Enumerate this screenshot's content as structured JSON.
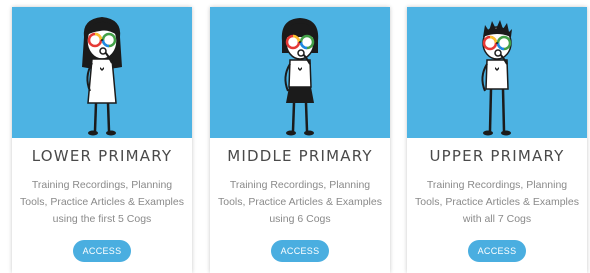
{
  "colors": {
    "hero_background": "#4db3e3",
    "button_background": "#4aaee0",
    "title_text": "#4a4a4a",
    "description_text": "#8a8a8a"
  },
  "cards": [
    {
      "title": "LOWER PRIMARY",
      "description": "Training Recordings, Planning Tools, Practice Articles & Examples using the first 5 Cogs",
      "button_label": "ACCESS",
      "illustration_icon": "girl-long-hair-rainbow-glasses-icon"
    },
    {
      "title": "MIDDLE PRIMARY",
      "description": "Training Recordings, Planning Tools, Practice Articles & Examples using 6 Cogs",
      "button_label": "ACCESS",
      "illustration_icon": "girl-bob-hair-rainbow-glasses-icon"
    },
    {
      "title": "UPPER PRIMARY",
      "description": "Training Recordings, Planning Tools, Practice Articles & Examples with all 7 Cogs",
      "button_label": "ACCESS",
      "illustration_icon": "boy-spiky-hair-rainbow-glasses-icon"
    }
  ]
}
